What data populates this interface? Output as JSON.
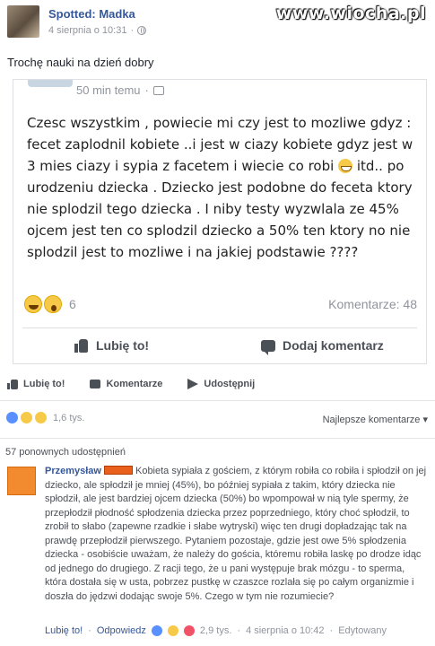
{
  "watermark": "www.wiocha.pl",
  "post": {
    "page_name": "Spotted: Madka",
    "timestamp": "4 sierpnia o 10:31",
    "text": "Trochę nauki na dzień dobry"
  },
  "card": {
    "time": "50 min temu",
    "body": "Czesc wszystkim , powiecie mi czy jest to mozliwe gdyz : fecet zaplodnil kobiete ..i jest w ciazy kobiete gdyz jest w 3 mies ciazy i sypia z facetem i wiecie co robi",
    "body_after_emoji": " itd.. po urodzeniu dziecka . Dziecko jest podobne do feceta ktory nie splodzil tego dziecka . I niby testy wyzwlala ze 45% ojcem jest ten co splodzil dziecko a 50% ten ktory no nie splodzil jest to mozliwe i na jakiej podstawie ????",
    "reaction_count": "6",
    "comments": "Komentarze: 48",
    "like_label": "Lubię to!",
    "comment_label": "Dodaj komentarz"
  },
  "actions": {
    "like": "Lubię to!",
    "comment": "Komentarze",
    "share": "Udostępnij"
  },
  "reactions": {
    "count": "1,6 tys.",
    "sort": "Najlepsze komentarze ▾"
  },
  "reshares": "57 ponownych udostępnień",
  "comment": {
    "author": "Przemysław",
    "text": "Kobieta sypiała z gościem, z którym robiła co robiła i spłodził on jej dziecko, ale spłodził je mniej (45%), bo później sypiała z takim, który dziecka nie spłodził, ale jest bardziej ojcem dziecka (50%) bo wpompował w nią tyle spermy, że przepłodził płodność spłodzenia dziecka przez poprzedniego, który choć spłodził, to zrobił to słabo (zapewne rzadkie i słabe wytryski) więc ten drugi dopładzając tak na prawdę przepłodził pierwszego. Pytaniem pozostaje, gdzie jest owe 5% spłodzenia dziecka - osobiście uważam, że należy do gościa, któremu robiła laskę po drodze idąc od jednego do drugiego. Z racji tego, że u pani występuje brak mózgu - to sperma, która dostała się w usta, pobrzez pustkę w czaszce rozlała się po całym organizmie i doszła do jędzwi dodając swoje 5%. Czego w tym nie rozumiecie?",
    "like": "Lubię to!",
    "reply": "Odpowiedz",
    "reaction_count": "2,9 tys.",
    "timestamp": "4 sierpnia o 10:42",
    "edited": "Edytowany"
  }
}
